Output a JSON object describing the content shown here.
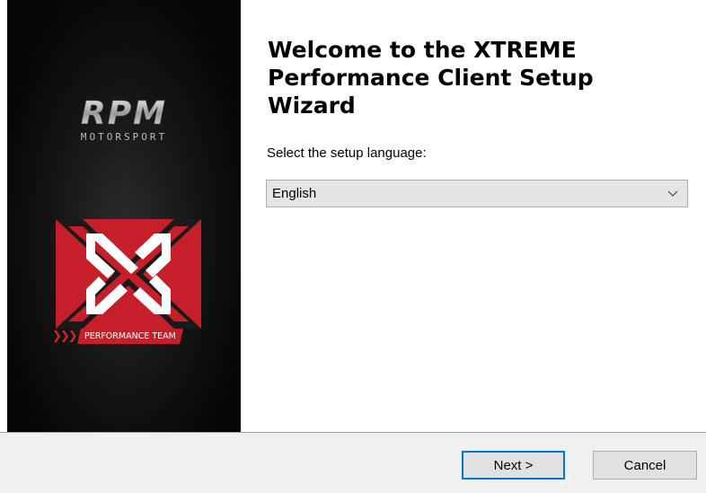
{
  "branding": {
    "rpm_wordmark": "RPM",
    "rpm_subtext": "MOTORSPORT",
    "team_label": "PERFORMANCE TEAM",
    "chevrons": "❯❯❯",
    "accent_color": "#c61f29"
  },
  "main": {
    "title": "Welcome to the XTREME Performance Client Setup Wizard",
    "language_prompt": "Select the setup language:",
    "language_selected": "English",
    "dropdown_icon": "chevron-down-icon"
  },
  "footer": {
    "next_label": "Next >",
    "cancel_label": "Cancel",
    "focus_color": "#0078d7"
  }
}
